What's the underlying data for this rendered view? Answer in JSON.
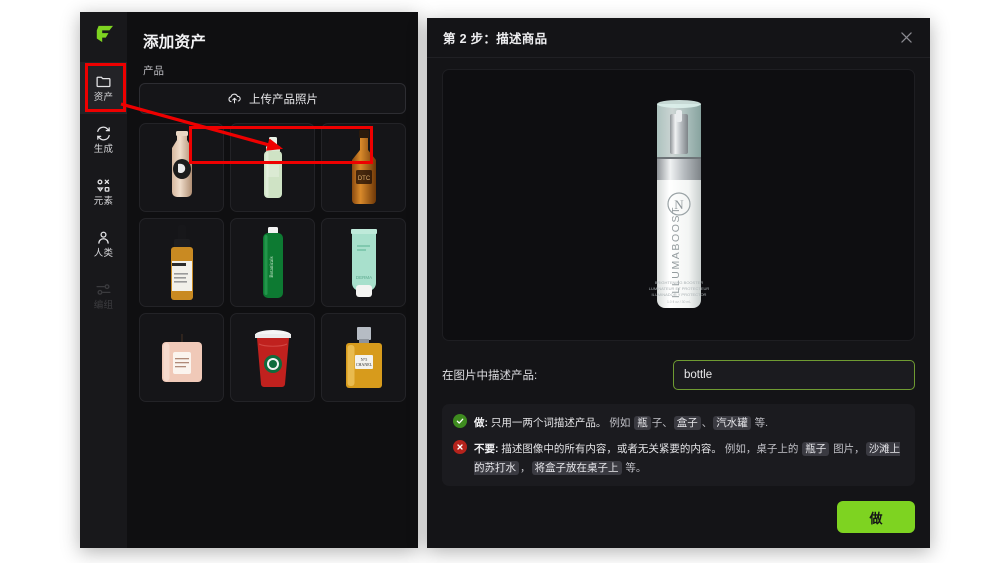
{
  "app": {
    "logo_icon": "flair-logo-icon",
    "sidebar": {
      "items": [
        {
          "label": "资产",
          "icon": "folder-icon",
          "active": true,
          "disabled": false
        },
        {
          "label": "生成",
          "icon": "refresh-icon",
          "active": false,
          "disabled": false
        },
        {
          "label": "元素",
          "icon": "shapes-icon",
          "active": false,
          "disabled": false
        },
        {
          "label": "人类",
          "icon": "person-icon",
          "active": false,
          "disabled": false
        },
        {
          "label": "编组",
          "icon": "sliders-icon",
          "active": false,
          "disabled": true
        }
      ]
    },
    "panel": {
      "title": "添加资产",
      "section_label": "产品",
      "upload_button": "上传产品照片",
      "upload_icon": "cloud-upload-icon",
      "products": [
        {
          "name": "foundation-dropper-bottle",
          "alt": "米色粉底液瓶"
        },
        {
          "name": "green-mist-spray-bottle",
          "alt": "绿色喷雾瓶"
        },
        {
          "name": "whiskey-bottle",
          "alt": "威士忌酒瓶"
        },
        {
          "name": "amber-serum-dropper",
          "alt": "琥珀色精华滴管瓶"
        },
        {
          "name": "green-shampoo-bottle",
          "alt": "绿色洗发水瓶"
        },
        {
          "name": "mint-cream-tube",
          "alt": "薄荷色面霜软管"
        },
        {
          "name": "pink-candle-jar",
          "alt": "粉色香薰蜡烛"
        },
        {
          "name": "red-coffee-cup",
          "alt": "红色咖啡杯"
        },
        {
          "name": "gold-perfume-bottle",
          "alt": "金色香水瓶"
        }
      ]
    }
  },
  "modal": {
    "title": "第 2 步：描述商品",
    "close_icon": "close-icon",
    "preview": {
      "product_name": "ILLUMABOOST",
      "brand_mark": "N",
      "sublines": [
        "BRIGHTENING BOOSTER",
        "LUMINATEUR ET PROTECTEUR",
        "ILUMINADOR Y PROTECTOR"
      ],
      "volume": "1.0 fl oz / 30 mL"
    },
    "field": {
      "label": "在图片中描述产品:",
      "value": "bottle",
      "placeholder": "bottle",
      "border_color": "#6f9b32"
    },
    "tips": [
      {
        "kind": "do",
        "badge_icon": "check-circle-icon",
        "badge_color": "#3e8b1f",
        "heading": "做:",
        "heading_rest": " 只用一两个词描述产品。",
        "example_prefix": "例如 ",
        "example_parts": [
          {
            "text": "瓶",
            "chip": true
          },
          {
            "text": "子、",
            "chip": false
          },
          {
            "text": "盒子",
            "chip": true
          },
          {
            "text": "、",
            "chip": false
          },
          {
            "text": "汽水罐",
            "chip": true
          },
          {
            "text": " 等.",
            "chip": false
          }
        ]
      },
      {
        "kind": "dont",
        "badge_icon": "x-circle-icon",
        "badge_color": "#b5231c",
        "heading": "不要:",
        "heading_rest": " 描述图像中的所有内容，或者无关紧要的内容。",
        "example_prefix": "例如，桌子上的 ",
        "example_parts": [
          {
            "text": "瓶子",
            "chip": true
          },
          {
            "text": " 图片，",
            "chip": false
          },
          {
            "text": "沙滩上的苏打水",
            "chip": true
          },
          {
            "text": "，",
            "chip": false
          },
          {
            "text": "将盒子放在桌子上",
            "chip": true
          },
          {
            "text": " 等。",
            "chip": false
          }
        ]
      }
    ],
    "footer": {
      "primary_button": "做",
      "primary_color": "#7ed321"
    }
  },
  "annotations": {
    "color": "#ee0000",
    "highlight_sidebar_item": "资产",
    "highlight_button": "上传产品照片",
    "arrow_from": "资产",
    "arrow_to": "上传产品照片"
  }
}
